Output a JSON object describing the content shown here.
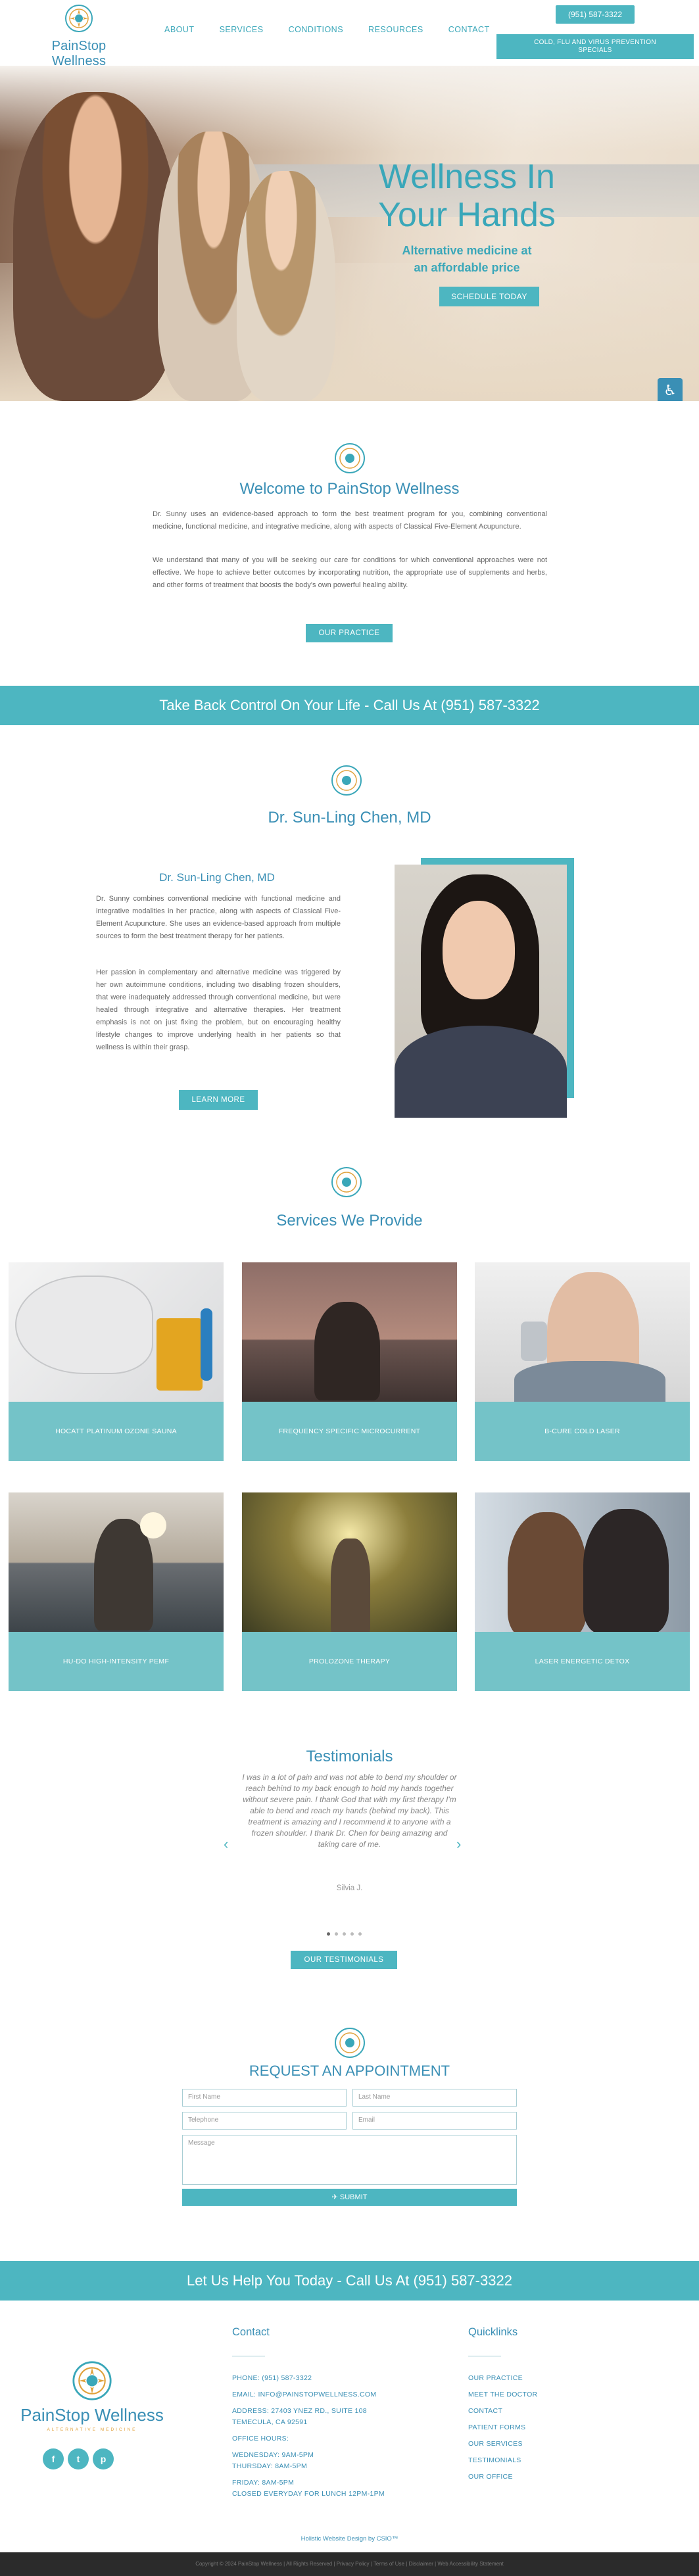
{
  "header": {
    "brand": "PainStop Wellness",
    "brand_sub": "ALTERNATIVE MEDICINE",
    "nav": [
      "ABOUT",
      "SERVICES",
      "CONDITIONS",
      "RESOURCES",
      "CONTACT"
    ],
    "phone_button": "(951) 587-3322",
    "covid_button_line1": "COLD, FLU AND VIRUS PREVENTION",
    "covid_button_line2": "SPECIALS"
  },
  "hero": {
    "title_line1": "Wellness In",
    "title_line2": "Your Hands",
    "subtitle_line1": "Alternative medicine at",
    "subtitle_line2": "an affordable price",
    "cta": "SCHEDULE TODAY",
    "accessibility_icon": "accessibility-icon"
  },
  "welcome": {
    "title": "Welcome to PainStop Wellness",
    "p1": "Dr. Sunny uses an evidence-based approach to form the best treatment program for you, combining conventional medicine, functional medicine, and integrative medicine, along with aspects of Classical Five-Element Acupuncture.",
    "p2": "We understand that many of you will be seeking our care for conditions for which conventional approaches were not effective. We hope to achieve better outcomes by incorporating nutrition, the appropriate use of supplements and herbs, and other forms of treatment that boosts the body's own powerful healing ability.",
    "button": "OUR PRACTICE"
  },
  "band1": "Take Back Control On Your Life - Call Us At (951) 587-3322",
  "doctor": {
    "title": "Dr. Sun-Ling Chen, MD",
    "subtitle": "Dr. Sun-Ling Chen, MD",
    "p1": "Dr. Sunny combines conventional medicine with functional medicine and integrative modalities in her practice, along with aspects of Classical Five-Element Acupuncture. She uses an evidence-based approach from multiple sources to form the best treatment therapy for her patients.",
    "p2": "Her passion in complementary and alternative medicine was triggered by her own autoimmune conditions, including two disabling frozen shoulders, that were inadequately addressed through conventional medicine, but were healed through integrative and alternative therapies. Her treatment emphasis is not on just fixing the problem, but on encouraging healthy lifestyle changes to improve underlying health in her patients so that wellness is within their grasp.",
    "button": "LEARN MORE"
  },
  "services": {
    "title": "Services We Provide",
    "items": [
      "HOCATT PLATINUM OZONE SAUNA",
      "FREQUENCY SPECIFIC MICROCURRENT",
      "B-CURE COLD LASER",
      "HU-DO HIGH-INTENSITY PEMF",
      "PROLOZONE THERAPY",
      "LASER ENERGETIC DETOX"
    ]
  },
  "testimonials": {
    "title": "Testimonials",
    "quote": "I was in a lot of pain and was not able to bend my shoulder or reach behind to my back enough to hold my hands together without severe pain. I thank God that with my first therapy I'm able to bend and reach my hands (behind my back). This treatment is amazing and I recommend it to anyone with a frozen shoulder. I thank Dr. Chen for being amazing and taking care of me.",
    "author": "Silvia J.",
    "button": "OUR TESTIMONIALS",
    "active_dot": 1,
    "dot_count": 5
  },
  "appointment": {
    "title": "REQUEST AN APPOINTMENT",
    "first_name": "First Name",
    "last_name": "Last Name",
    "telephone": "Telephone",
    "email": "Email",
    "message": "Message",
    "submit": "SUBMIT"
  },
  "band2": "Let Us Help You Today - Call Us At (951) 587-3322",
  "footer": {
    "contact_title": "Contact",
    "contact_lines": [
      "PHONE: (951) 587-3322",
      "EMAIL: INFO@PAINSTOPWELLNESS.COM",
      "ADDRESS: 27403 YNEZ RD., SUITE 108",
      "TEMECULA, CA 92591",
      "OFFICE HOURS:",
      "WEDNESDAY: 9AM-5PM",
      "THURSDAY: 8AM-5PM",
      "FRIDAY: 8AM-5PM",
      "CLOSED EVERYDAY FOR LUNCH 12PM-1PM"
    ],
    "quicklinks_title": "Quicklinks",
    "quicklinks": [
      "OUR PRACTICE",
      "MEET THE DOCTOR",
      "CONTACT",
      "PATIENT FORMS",
      "OUR SERVICES",
      "TESTIMONIALS",
      "OUR OFFICE"
    ],
    "social": [
      "f",
      "t",
      "p"
    ],
    "credit": "Holistic Website Design by CSIO™",
    "copyright": "Copyright © 2024 PainStop Wellness | All Rights Reserved | Privacy Policy | Terms of Use | Disclaimer | Web Accessibility Statement"
  },
  "colors": {
    "accent": "#4db6c1",
    "brand_blue": "#3a8fb5",
    "gold": "#e0a13b",
    "service_label": "#74c3c8"
  }
}
